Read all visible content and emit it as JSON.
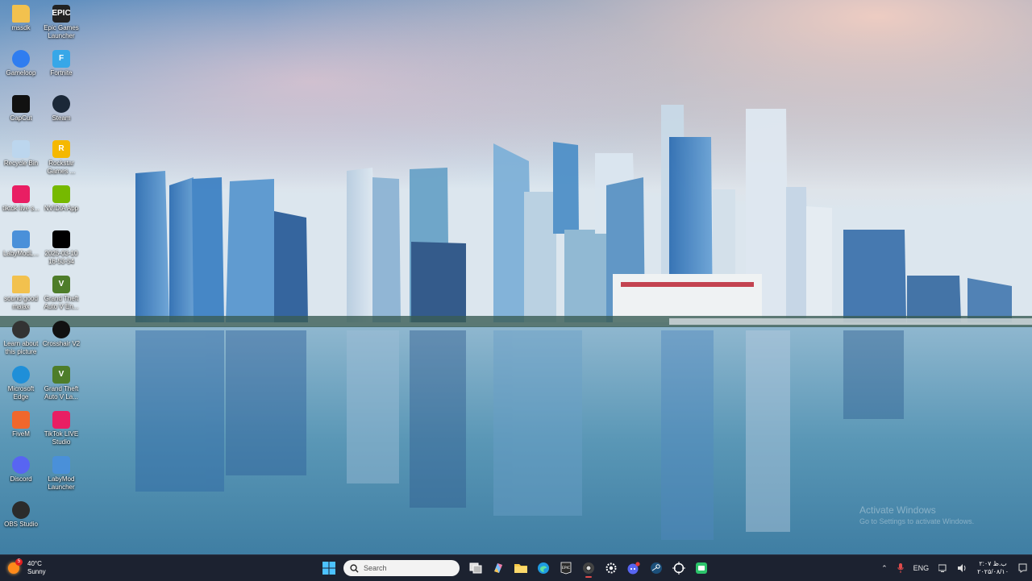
{
  "desktop": {
    "icons": [
      {
        "label": "mssdk",
        "icon": "folder-icon",
        "color": "#f2c14e"
      },
      {
        "label": "Epic Games Launcher",
        "icon": "epic-games-icon",
        "color": "#222222",
        "glyph": "EPIC"
      },
      {
        "label": "Gameloop",
        "icon": "gameloop-icon",
        "color": "#2f7df0"
      },
      {
        "label": "Fortnite",
        "icon": "fortnite-icon",
        "color": "#37a7e8",
        "glyph": "F"
      },
      {
        "label": "CapCut",
        "icon": "capcut-icon",
        "color": "#111111"
      },
      {
        "label": "Steam",
        "icon": "steam-icon",
        "color": "#1b2838"
      },
      {
        "label": "Recycle Bin",
        "icon": "recycle-bin-icon",
        "color": "#bcd6ee"
      },
      {
        "label": "Rockstar Games ...",
        "icon": "rockstar-games-icon",
        "color": "#f5b800",
        "glyph": "R"
      },
      {
        "label": "tiktok live s...",
        "icon": "tiktok-live-icon",
        "color": "#e91e63"
      },
      {
        "label": "NVIDIA App",
        "icon": "nvidia-icon",
        "color": "#76b900"
      },
      {
        "label": "LabyModL...",
        "icon": "labymod-icon",
        "color": "#4a90d9"
      },
      {
        "label": "2025-03-10 16-53-54",
        "icon": "video-file-icon",
        "color": "#000000"
      },
      {
        "label": "sound good maiax",
        "icon": "folder-icon",
        "color": "#f2c14e"
      },
      {
        "label": "Grand Theft Auto V En...",
        "icon": "gta-v-icon",
        "color": "#4e7d2a",
        "glyph": "V"
      },
      {
        "label": "Learn about this picture",
        "icon": "learn-about-picture-icon",
        "color": "#333333"
      },
      {
        "label": "Crosshair V2",
        "icon": "crosshair-icon",
        "color": "#111111"
      },
      {
        "label": "Microsoft Edge",
        "icon": "edge-icon",
        "color": "#1f8fd8"
      },
      {
        "label": "Grand Theft Auto V La...",
        "icon": "gta-v-icon",
        "color": "#4e7d2a",
        "glyph": "V"
      },
      {
        "label": "FiveM",
        "icon": "fivem-icon",
        "color": "#f0672c"
      },
      {
        "label": "TikTok LIVE Studio",
        "icon": "tiktok-live-studio-icon",
        "color": "#e91e63"
      },
      {
        "label": "Discord",
        "icon": "discord-icon",
        "color": "#5865f2"
      },
      {
        "label": "LabyMod Launcher",
        "icon": "labymod-icon",
        "color": "#4a90d9"
      },
      {
        "label": "OBS Studio",
        "icon": "obs-icon",
        "color": "#2b2b2b"
      }
    ]
  },
  "watermark": {
    "title": "Activate Windows",
    "subtitle": "Go to Settings to activate Windows."
  },
  "taskbar": {
    "weather": {
      "temp": "40°C",
      "condition": "Sunny",
      "badge": "5"
    },
    "search_placeholder": "Search",
    "apps": [
      {
        "name": "start-button",
        "icon": "windows-logo-icon"
      },
      {
        "name": "task-view-button",
        "icon": "task-view-icon"
      },
      {
        "name": "copilot-button",
        "icon": "copilot-icon"
      },
      {
        "name": "file-explorer-button",
        "icon": "folder-icon"
      },
      {
        "name": "edge-button",
        "icon": "edge-icon"
      },
      {
        "name": "epic-games-button",
        "icon": "epic-games-icon"
      },
      {
        "name": "chrome-button",
        "icon": "chrome-icon"
      },
      {
        "name": "settings-button",
        "icon": "gear-icon"
      },
      {
        "name": "discord-button",
        "icon": "discord-icon"
      },
      {
        "name": "steam-button",
        "icon": "steam-icon"
      },
      {
        "name": "crosshair-button",
        "icon": "crosshair-icon"
      },
      {
        "name": "app-button",
        "icon": "green-app-icon"
      }
    ],
    "tray": {
      "language": "ENG",
      "time": "۲:۰۷ ب.ظ",
      "date": "۲۰۲۵/۰۸/۱۰"
    }
  }
}
